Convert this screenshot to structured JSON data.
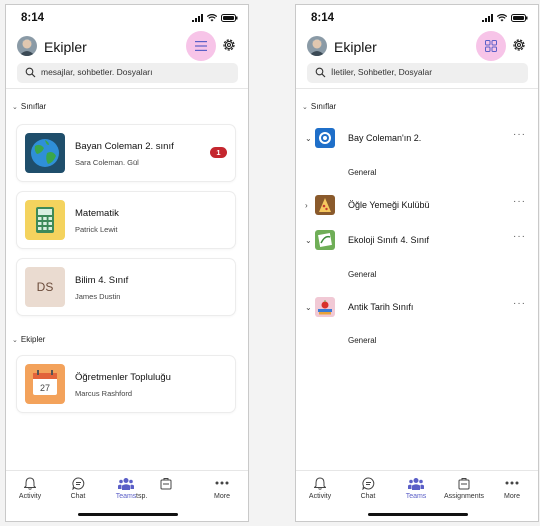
{
  "left": {
    "time": "8:14",
    "title": "Ekipler",
    "search_placeholder": "mesajlar, sohbetler. Dosyaları",
    "section_classes": "Sınıflar",
    "section_teams": "Ekipler",
    "cards": [
      {
        "title": "Bayan Coleman 2. sınıf",
        "subtitle": "Sara Coleman. Gül",
        "badge": "1"
      },
      {
        "title": "Matematik",
        "subtitle": "Patrick Lewit"
      },
      {
        "title": "Bilim 4. Sınıf",
        "subtitle": "James Dustin",
        "thumb_text": "DS"
      },
      {
        "title": "Öğretmenler Topluluğu",
        "subtitle": "Marcus Rashford",
        "thumb_text": "27"
      }
    ],
    "tabs": [
      "Activity",
      "Chat",
      "Teams",
      "tsp.",
      "More"
    ]
  },
  "right": {
    "time": "8:14",
    "title": "Ekipler",
    "search_placeholder": "İletiler, Sohbetler, Dosyalar",
    "section_classes": "Sınıflar",
    "teams": [
      {
        "label": "Bay Coleman'ın 2.",
        "channel": "General"
      },
      {
        "label": "Öğle Yemeği Kulübü"
      },
      {
        "label": "Ekoloji Sınıfı 4. Sınıf",
        "channel": "General"
      },
      {
        "label": "Antik Tarih Sınıfı",
        "channel": "General"
      }
    ],
    "more_label": "···",
    "tabs": [
      "Activity",
      "Chat",
      "Teams",
      "Assignments",
      "More"
    ]
  },
  "colors": {
    "accent": "#5b5fc7",
    "highlight": "#f7c4e8",
    "badge": "#c4262e"
  }
}
